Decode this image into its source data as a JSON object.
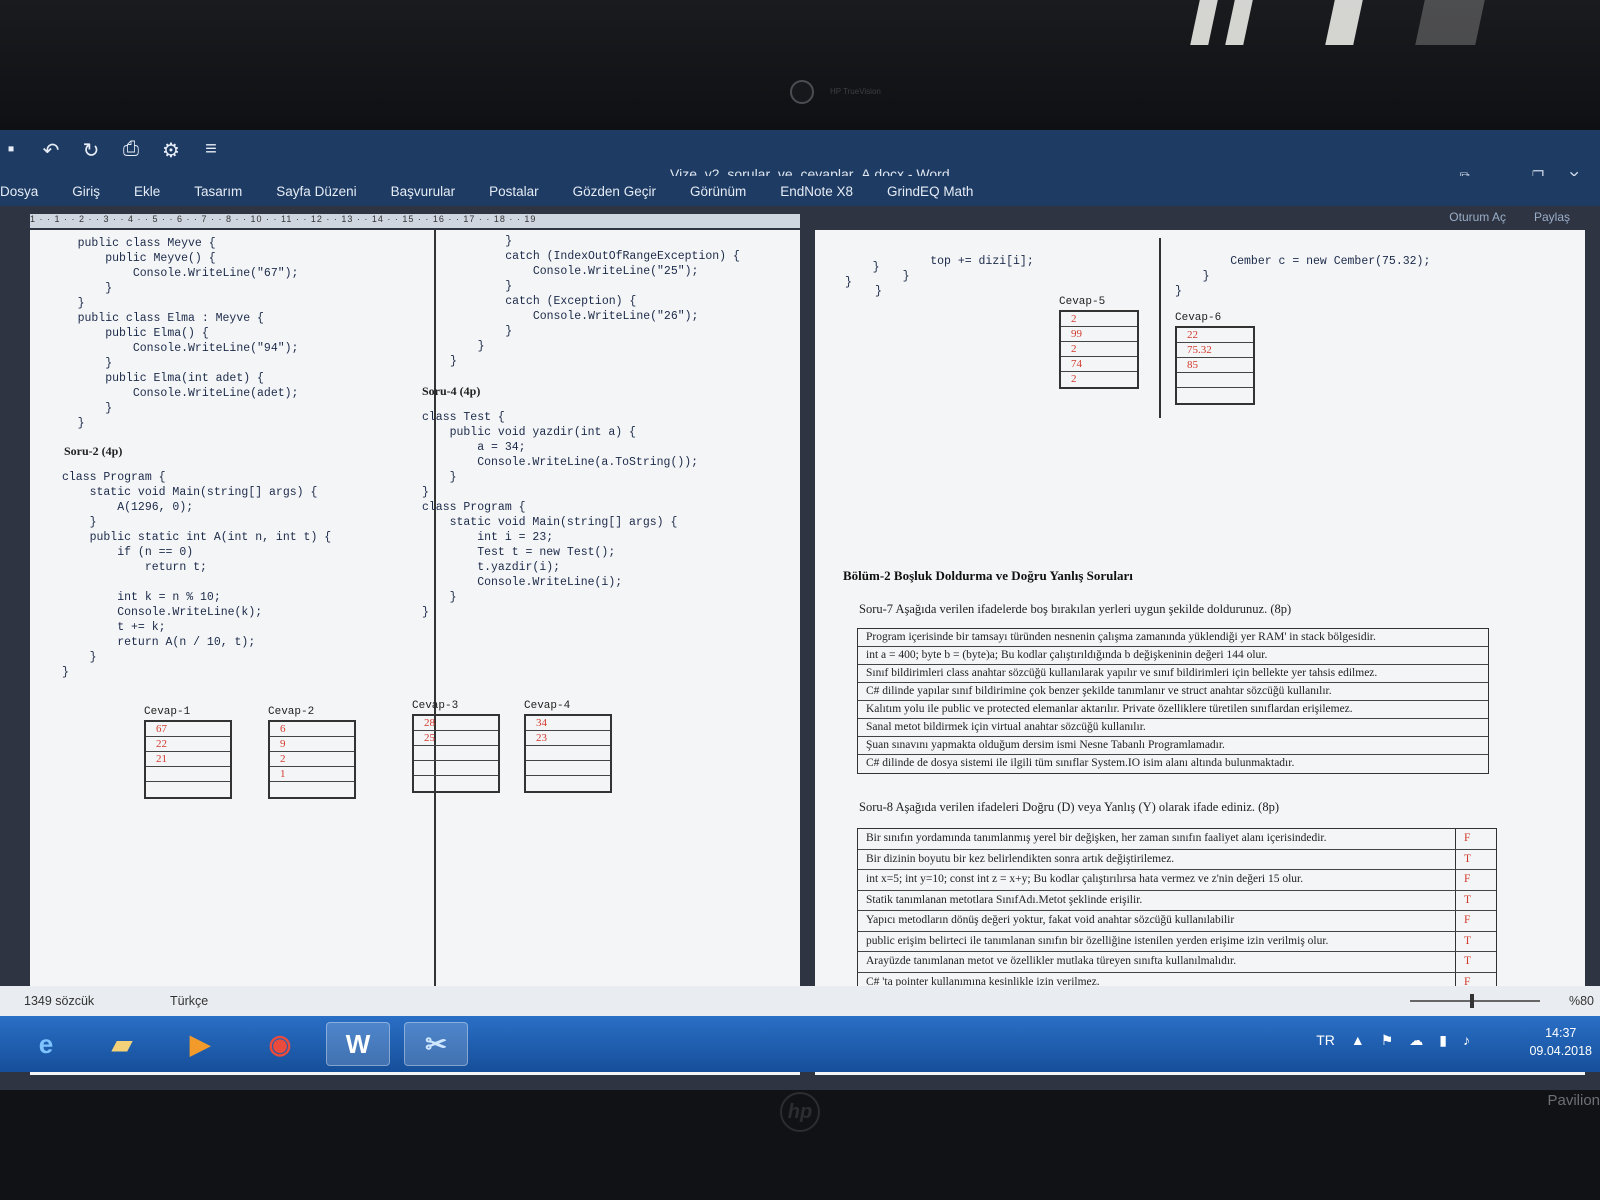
{
  "window": {
    "title": "Vize_v2_sorular_ve_cevaplar_A.docx - Word",
    "controls": [
      "⧉",
      "—",
      "❐",
      "✕"
    ]
  },
  "quick_access": [
    "save-icon",
    "undo-icon",
    "redo-icon",
    "print-preview-icon",
    "customize-icon"
  ],
  "ribbon": {
    "tabs": [
      "Dosya",
      "Giriş",
      "Ekle",
      "Tasarım",
      "Sayfa Düzeni",
      "Başvurular",
      "Postalar",
      "Gözden Geçir",
      "Görünüm",
      "EndNote X8",
      "GrindEQ Math"
    ],
    "sign_in": "Oturum Aç",
    "share": "Paylaş"
  },
  "ruler_text": "1 · · 1 · · 2 · · 3 · · 4 · · 5 · · 6 · · 7 · · 8 · · 10 · · 11 · · 12 · · 13 · · 14 · · 15 · · 16 · · 17 · · 18 · · 19",
  "left_page": {
    "code_top": "    public class Meyve {\n        public Meyve() {\n            Console.WriteLine(\"67\");\n        }\n    }\n    public class Elma : Meyve {\n        public Elma() {\n            Console.WriteLine(\"94\");\n        }\n        public Elma(int adet) {\n            Console.WriteLine(adet);\n        }\n    }",
    "soru2_title": "Soru-2 (4p)",
    "soru2_code": "class Program {\n    static void Main(string[] args) {\n        A(1296, 0);\n    }\n    public static int A(int n, int t) {\n        if (n == 0)\n            return t;\n\n        int k = n % 10;\n        Console.WriteLine(k);\n        t += k;\n        return A(n / 10, t);\n    }\n}",
    "col2_code_top": "        }\n        catch (IndexOutOfRangeException) {\n            Console.WriteLine(\"25\");\n        }\n        catch (Exception) {\n            Console.WriteLine(\"26\");\n        }\n    }\n}",
    "soru4_title": "Soru-4 (4p)",
    "soru4_code": "class Test {\n    public void yazdir(int a) {\n        a = 34;\n        Console.WriteLine(a.ToString());\n    }\n}\nclass Program {\n    static void Main(string[] args) {\n        int i = 23;\n        Test t = new Test();\n        t.yazdir(i);\n        Console.WriteLine(i);\n    }\n}",
    "answers": [
      {
        "label": "Cevap-1",
        "cells": [
          "67",
          "22",
          "21",
          "",
          ""
        ]
      },
      {
        "label": "Cevap-2",
        "cells": [
          "6",
          "9",
          "2",
          "1",
          ""
        ]
      },
      {
        "label": "Cevap-3",
        "cells": [
          "28",
          "25",
          "",
          "",
          ""
        ]
      },
      {
        "label": "Cevap-4",
        "cells": [
          "34",
          "23",
          "",
          "",
          ""
        ]
      }
    ]
  },
  "right_page": {
    "code_fragment_1": "    }\n}",
    "code_fragment_2": "        top += dizi[i];\n    }\n}",
    "code_fragment_3": "        Cember c = new Cember(75.32);\n    }\n}",
    "answers": [
      {
        "label": "Cevap-5",
        "cells": [
          "2",
          "99",
          "2",
          "74",
          "2"
        ]
      },
      {
        "label": "Cevap-6",
        "cells": [
          "22",
          "75.32",
          "85",
          "",
          ""
        ]
      }
    ],
    "section_title": "Bölüm-2 Boşluk Doldurma ve Doğru Yanlış Soruları",
    "soru7": "Soru-7 Aşağıda verilen ifadelerde boş bırakılan yerleri uygun şekilde doldurunuz. (8p)",
    "fill_rows": [
      "Program içerisinde bir tamsayı türünden nesnenin çalışma zamanında yüklendiği yer RAM' in stack bölgesidir.",
      "int a = 400; byte b = (byte)a; Bu kodlar çalıştırıldığında b değişkeninin değeri 144 olur.",
      "Sınıf bildirimleri class anahtar sözcüğü kullanılarak yapılır ve sınıf bildirimleri için bellekte yer tahsis edilmez.",
      "C# dilinde yapılar sınıf bildirimine çok benzer şekilde tanımlanır ve struct anahtar sözcüğü kullanılır.",
      "Kalıtım yolu ile public ve protected elemanlar aktarılır. Private özelliklere türetilen sınıflardan erişilemez.",
      "Sanal metot bildirmek için virtual anahtar sözcüğü kullanılır.",
      "Şuan sınavını yapmakta olduğum dersim ismi Nesne Tabanlı Programlamadır.",
      "C# dilinde de dosya sistemi ile ilgili tüm sınıflar System.IO isim alanı altında bulunmaktadır."
    ],
    "soru8": "Soru-8 Aşağıda verilen ifadeleri Doğru (D) veya Yanlış (Y) olarak ifade ediniz. (8p)",
    "tf_rows": [
      {
        "text": "Bir sınıfın yordamında tanımlanmış yerel bir değişken, her zaman sınıfın faaliyet alanı içerisindedir.",
        "answer": "F"
      },
      {
        "text": "Bir dizinin boyutu bir kez belirlendikten sonra artık değiştirilemez.",
        "answer": "T"
      },
      {
        "text": "int x=5; int y=10; const int z = x+y; Bu kodlar çalıştırılırsa hata vermez ve z'nin değeri 15 olur.",
        "answer": "F"
      },
      {
        "text": "Statik tanımlanan metotlara SınıfAdı.Metot şeklinde erişilir.",
        "answer": "T"
      },
      {
        "text": "Yapıcı metodların dönüş değeri yoktur, fakat void anahtar sözcüğü kullanılabilir",
        "answer": "F"
      },
      {
        "text": "public erişim belirteci ile tanımlanan sınıfın bir özelliğine istenilen yerden erişime izin verilmiş olur.",
        "answer": "T"
      },
      {
        "text": "Arayüzde tanımlanan metot ve özellikler mutlaka türeyen sınıfta kullanılmalıdır.",
        "answer": "T"
      },
      {
        "text": "C# 'ta pointer kullanımına kesinlikle izin verilmez.",
        "answer": "F"
      }
    ]
  },
  "statusbar": {
    "word_count": "1349 sözcük",
    "language": "Türkçe",
    "zoom": "%80"
  },
  "taskbar": {
    "apps": [
      "ie-icon",
      "explorer-icon",
      "media-player-icon",
      "chrome-icon",
      "word-icon",
      "snipping-icon"
    ],
    "lang": "TR",
    "time": "14:37",
    "date": "09.04.2018"
  },
  "hardware": {
    "camera_label": "HP TrueVision",
    "brand": "hp",
    "model": "Pavilion"
  },
  "colors": {
    "ribbon": "#1e3b63",
    "answer_red": "#d23a2e",
    "taskbar": "#2a6fc6"
  }
}
